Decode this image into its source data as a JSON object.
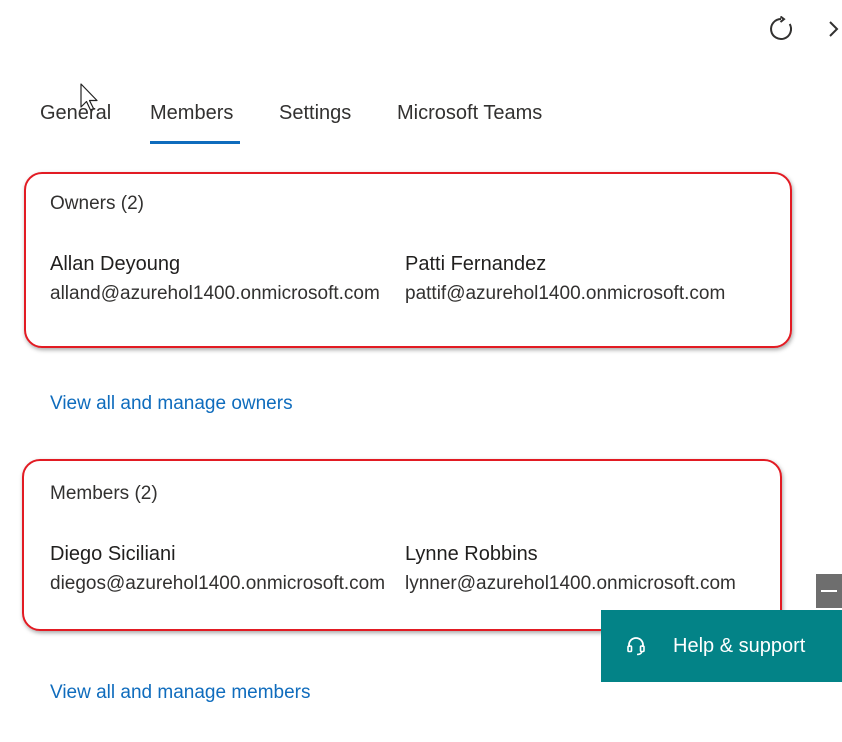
{
  "toolbar": {
    "refresh_icon": "refresh-icon",
    "next_icon": "chevron-right-icon"
  },
  "tabs": [
    {
      "label": "General",
      "selected": false
    },
    {
      "label": "Members",
      "selected": true
    },
    {
      "label": "Settings",
      "selected": false
    },
    {
      "label": "Microsoft Teams",
      "selected": false
    }
  ],
  "owners": {
    "title": "Owners (2)",
    "people": [
      {
        "name": "Allan Deyoung",
        "email": "alland@azurehol1400.onmicrosoft.com"
      },
      {
        "name": "Patti Fernandez",
        "email": "pattif@azurehol1400.onmicrosoft.com"
      }
    ],
    "manage_link": "View all and manage owners"
  },
  "members": {
    "title": "Members (2)",
    "people": [
      {
        "name": "Diego Siciliani",
        "email": "diegos@azurehol1400.onmicrosoft.com"
      },
      {
        "name": "Lynne Robbins",
        "email": "lynner@azurehol1400.onmicrosoft.com"
      }
    ],
    "manage_link": "View all and manage members"
  },
  "help": {
    "label": "Help & support",
    "icon": "headset-icon"
  },
  "colors": {
    "accent": "#0f6cbd",
    "highlight_border": "#e21b23",
    "help_background": "#038387"
  }
}
